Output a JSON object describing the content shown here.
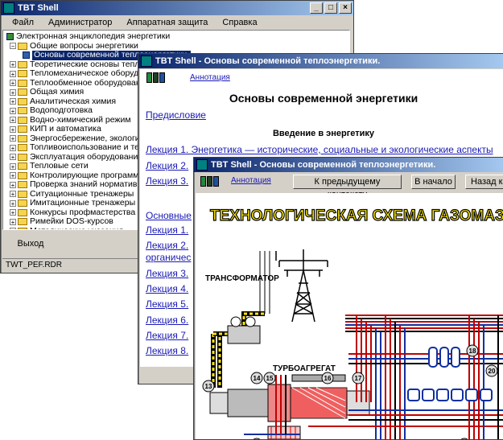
{
  "win1": {
    "title": "TBT Shell",
    "menu": [
      "Файл",
      "Администратор",
      "Аппаратная защита",
      "Справка"
    ],
    "tree": [
      {
        "label": "Электронная энциклопедия энергетики",
        "type": "root"
      },
      {
        "label": "Общие вопросы энергетики",
        "type": "open"
      },
      {
        "label": "Основы современной теплоэнергетики.",
        "type": "leaf"
      },
      {
        "label": "Теоретические основы теплоте",
        "type": "folder"
      },
      {
        "label": "Тепломеханическое оборудова",
        "type": "folder"
      },
      {
        "label": "Теплообменное оборудование",
        "type": "folder"
      },
      {
        "label": "Общая химия",
        "type": "folder"
      },
      {
        "label": "Аналитическая химия",
        "type": "folder"
      },
      {
        "label": "Водоподготовка",
        "type": "folder"
      },
      {
        "label": "Водно-химический режим",
        "type": "folder"
      },
      {
        "label": "КИП и автоматика",
        "type": "folder"
      },
      {
        "label": "Энергосбережение, экология и",
        "type": "folder"
      },
      {
        "label": "Топливоиспользование и технол",
        "type": "folder"
      },
      {
        "label": "Эксплуатация оборудования",
        "type": "folder"
      },
      {
        "label": "Тепловые сети",
        "type": "folder"
      },
      {
        "label": "Контролирующие программы",
        "type": "folder"
      },
      {
        "label": "Проверка знаний нормативно-т",
        "type": "folder"
      },
      {
        "label": "Ситуационные тренажеры",
        "type": "folder"
      },
      {
        "label": "Имитационные тренажеры",
        "type": "folder"
      },
      {
        "label": "Конкурсы профмастерства",
        "type": "folder"
      },
      {
        "label": "Римейки DOS-курсов",
        "type": "folder"
      },
      {
        "label": "Методические указания",
        "type": "folder"
      },
      {
        "label": "Общие файлы",
        "type": "folder"
      }
    ],
    "exit_label": "Выход",
    "status": "TWT_PEF.RDR"
  },
  "win2": {
    "title": "TBT Shell - Основы современной теплоэнергетики.",
    "annotation": "Аннотация",
    "heading": "Основы современной энергетики",
    "preface": "Предисловие",
    "subheading": "Введение в энергетику",
    "lectures_top": [
      "Лекция 1. Энергетика — исторические, социальные и экологические аспекты",
      "Лекция 2.",
      "Лекция 3."
    ],
    "section": "Основные",
    "lectures_bottom": [
      "Лекция 1.",
      "Лекция 2.",
      "органичес",
      "Лекция 3.",
      "Лекция 4.",
      "Лекция 5.",
      "Лекция 6.",
      "Лекция 7.",
      "Лекция 8."
    ]
  },
  "win3": {
    "title": "TBT Shell - Основы современной теплоэнергетики.",
    "annotation": "Аннотация",
    "btn_prev": "К предыдущему контексту",
    "btn_home": "В начало",
    "btn_back": "Назад к",
    "diagram_title": "ТЕХНОЛОГИЧЕСКАЯ СХЕМА ГАЗОМАЗ",
    "labels": {
      "transformer": "ТРАНСФОРМАТОР",
      "turbo": "ТУРБОАГРЕГАТ"
    },
    "callouts": [
      "13",
      "14",
      "15",
      "16",
      "17",
      "18",
      "12",
      "3",
      "20"
    ]
  },
  "colors": {
    "title_active": "#0a246a",
    "title_gradient_end": "#a6caf0",
    "link": "#1a1ab4",
    "diagram_title": "#ffea00",
    "pipe_red": "#c00000",
    "pipe_blue": "#1030a0"
  }
}
